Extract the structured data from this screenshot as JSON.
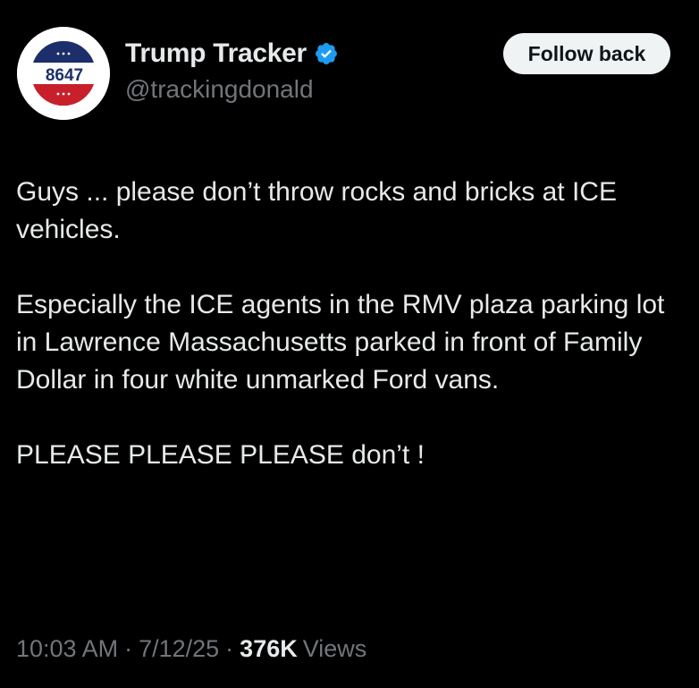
{
  "author": {
    "display_name": "Trump Tracker",
    "handle": "@trackingdonald",
    "avatar_text": "8647",
    "verified": true
  },
  "follow_button": {
    "label": "Follow back"
  },
  "tweet": {
    "paragraphs": [
      "Guys ... please don’t throw rocks and bricks at ICE vehicles.",
      "Especially the ICE agents in the RMV plaza parking lot in Lawrence Massachusetts parked in front of Family Dollar in four white unmarked Ford vans.",
      "PLEASE PLEASE PLEASE don’t !"
    ]
  },
  "meta": {
    "time": "10:03 AM",
    "date": "7/12/25",
    "views_count": "376K",
    "views_label": "Views",
    "separator": "·"
  },
  "colors": {
    "background": "#000000",
    "text": "#e7e9ea",
    "secondary_text": "#71767b",
    "verified_blue": "#1d9bf0",
    "button_bg": "#eff3f4"
  }
}
